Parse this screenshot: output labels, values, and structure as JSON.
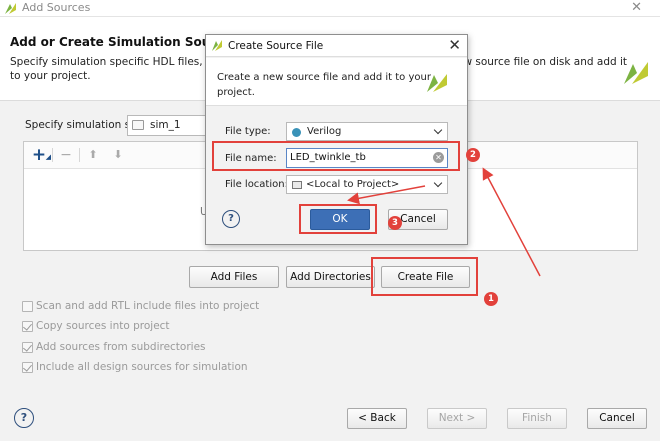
{
  "window": {
    "title": "Add Sources",
    "close_glyph": "✕",
    "app_icon": "vivado-logo-icon"
  },
  "header": {
    "heading": "Add or Create Simulation Sources",
    "desc_line1_left": "Specify simulation specific HDL files, or direc",
    "desc_line1_right": "ew source file on disk and add it",
    "desc_line2": "to your project."
  },
  "simulation_set": {
    "label": "Specify simulation set:",
    "value": "sim_1"
  },
  "file_list": {
    "toolbar": {
      "add_icon": "plus-icon",
      "remove_icon": "minus-icon",
      "up_icon": "arrow-up-icon",
      "down_icon": "arrow-down-icon",
      "add_glyph": "+",
      "remove_glyph": "−",
      "up_glyph": "⬆",
      "down_glyph": "⬇"
    },
    "hint_fragment": "U"
  },
  "buttons": {
    "add_files": "Add Files",
    "add_directories": "Add Directories",
    "create_file": "Create File"
  },
  "options": [
    {
      "label": "Scan and add RTL include files into project",
      "checked": false
    },
    {
      "label": "Copy sources into project",
      "checked": true
    },
    {
      "label": "Add sources from subdirectories",
      "checked": true
    },
    {
      "label": "Include all design sources for simulation",
      "checked": true
    }
  ],
  "footer": {
    "help": "?",
    "back": "< Back",
    "next": "Next >",
    "finish": "Finish",
    "cancel": "Cancel"
  },
  "dialog": {
    "title": "Create Source File",
    "close_glyph": "✕",
    "description_line1": "Create a new source file and add it to your",
    "description_line2": "project.",
    "file_type_label": "File type:",
    "file_type_value": "Verilog",
    "file_name_label": "File name:",
    "file_name_value": "LED_twinkle_tb",
    "file_location_label": "File location:",
    "file_location_value": "<Local to Project>",
    "help": "?",
    "ok": "OK",
    "cancel": "Cancel",
    "clear_glyph": "✕"
  },
  "annotations": {
    "badge_1": "1",
    "badge_2": "2",
    "badge_3": "3",
    "color": "#e2413b"
  }
}
